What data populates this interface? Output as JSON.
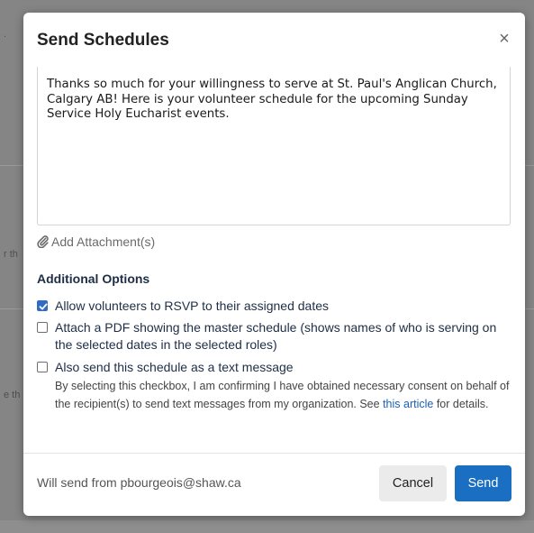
{
  "background": {
    "fragments": [
      ".",
      "r th",
      "e th"
    ]
  },
  "modal": {
    "title": "Send Schedules",
    "close_glyph": "×"
  },
  "message": {
    "text": "Thanks so much for your willingness to serve at St. Paul's Anglican Church, Calgary AB! Here is your volunteer schedule for the upcoming Sunday Service Holy Eucharist events."
  },
  "attachment": {
    "label": "Add Attachment(s)",
    "icon": "paperclip-icon"
  },
  "options": {
    "title": "Additional Options",
    "rsvp": {
      "label": "Allow volunteers to RSVP to their assigned dates",
      "checked": true
    },
    "pdf": {
      "label": "Attach a PDF showing the master schedule (shows names of who is serving on the selected dates in the selected roles)",
      "checked": false
    },
    "sms": {
      "label": "Also send this schedule as a text message",
      "checked": false,
      "disclaimer_before": "By selecting this checkbox, I am confirming I have obtained necessary consent on behalf of the recipient(s) to send text messages from my organization. See ",
      "disclaimer_link": "this article",
      "disclaimer_after": " for details."
    }
  },
  "footer": {
    "from_text": "Will send from pbourgeois@shaw.ca",
    "cancel_label": "Cancel",
    "send_label": "Send"
  },
  "colors": {
    "accent": "#1a6fc2",
    "checkbox_checked": "#2f6cc8",
    "link": "#1a5fb4",
    "heading": "#1e2e46"
  }
}
